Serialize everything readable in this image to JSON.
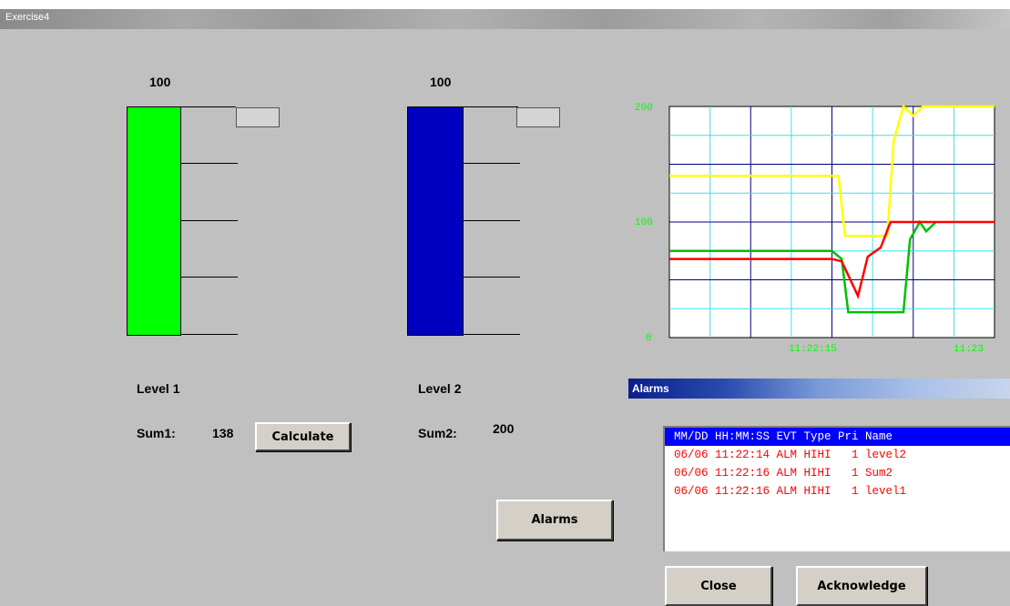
{
  "window": {
    "title": "Exercise4"
  },
  "level1": {
    "max_label": "100",
    "label": "Level 1",
    "sum_label": "Sum1:",
    "sum_value": "138",
    "color": "#00ff00",
    "fill_fraction": 1.0
  },
  "level2": {
    "max_label": "100",
    "label": "Level 2",
    "sum_label": "Sum2:",
    "sum_value": "200",
    "color": "#0000c0",
    "fill_fraction": 1.0
  },
  "buttons": {
    "calculate": "Calculate",
    "alarms": "Alarms"
  },
  "chart_data": {
    "type": "line",
    "y_ticks": [
      "200",
      "100",
      "0"
    ],
    "ylim": [
      0,
      200
    ],
    "x_ticks": [
      "11:22:15",
      "11:23"
    ],
    "series": [
      {
        "color": "#ffff00",
        "points": [
          [
            0,
            140
          ],
          [
            0.52,
            140
          ],
          [
            0.54,
            88
          ],
          [
            0.67,
            88
          ],
          [
            0.69,
            170
          ],
          [
            0.72,
            200
          ],
          [
            0.75,
            192
          ],
          [
            0.78,
            200
          ],
          [
            1,
            200
          ]
        ]
      },
      {
        "color": "#00c000",
        "points": [
          [
            0,
            75
          ],
          [
            0.5,
            75
          ],
          [
            0.53,
            68
          ],
          [
            0.55,
            22
          ],
          [
            0.72,
            22
          ],
          [
            0.74,
            85
          ],
          [
            0.77,
            100
          ],
          [
            0.79,
            92
          ],
          [
            0.82,
            100
          ]
        ]
      },
      {
        "color": "#ff0000",
        "points": [
          [
            0,
            68
          ],
          [
            0.5,
            68
          ],
          [
            0.53,
            66
          ],
          [
            0.58,
            36
          ],
          [
            0.61,
            70
          ],
          [
            0.65,
            78
          ],
          [
            0.68,
            100
          ],
          [
            1,
            100
          ]
        ]
      }
    ]
  },
  "alarms_dialog": {
    "title": "Alarms",
    "header": "MM/DD HH:MM:SS EVT Type Pri Name",
    "rows": [
      "06/06 11:22:14 ALM HIHI   1 level2",
      "06/06 11:22:16 ALM HIHI   1 Sum2",
      "06/06 11:22:16 ALM HIHI   1 level1"
    ],
    "close": "Close",
    "acknowledge": "Acknowledge"
  }
}
